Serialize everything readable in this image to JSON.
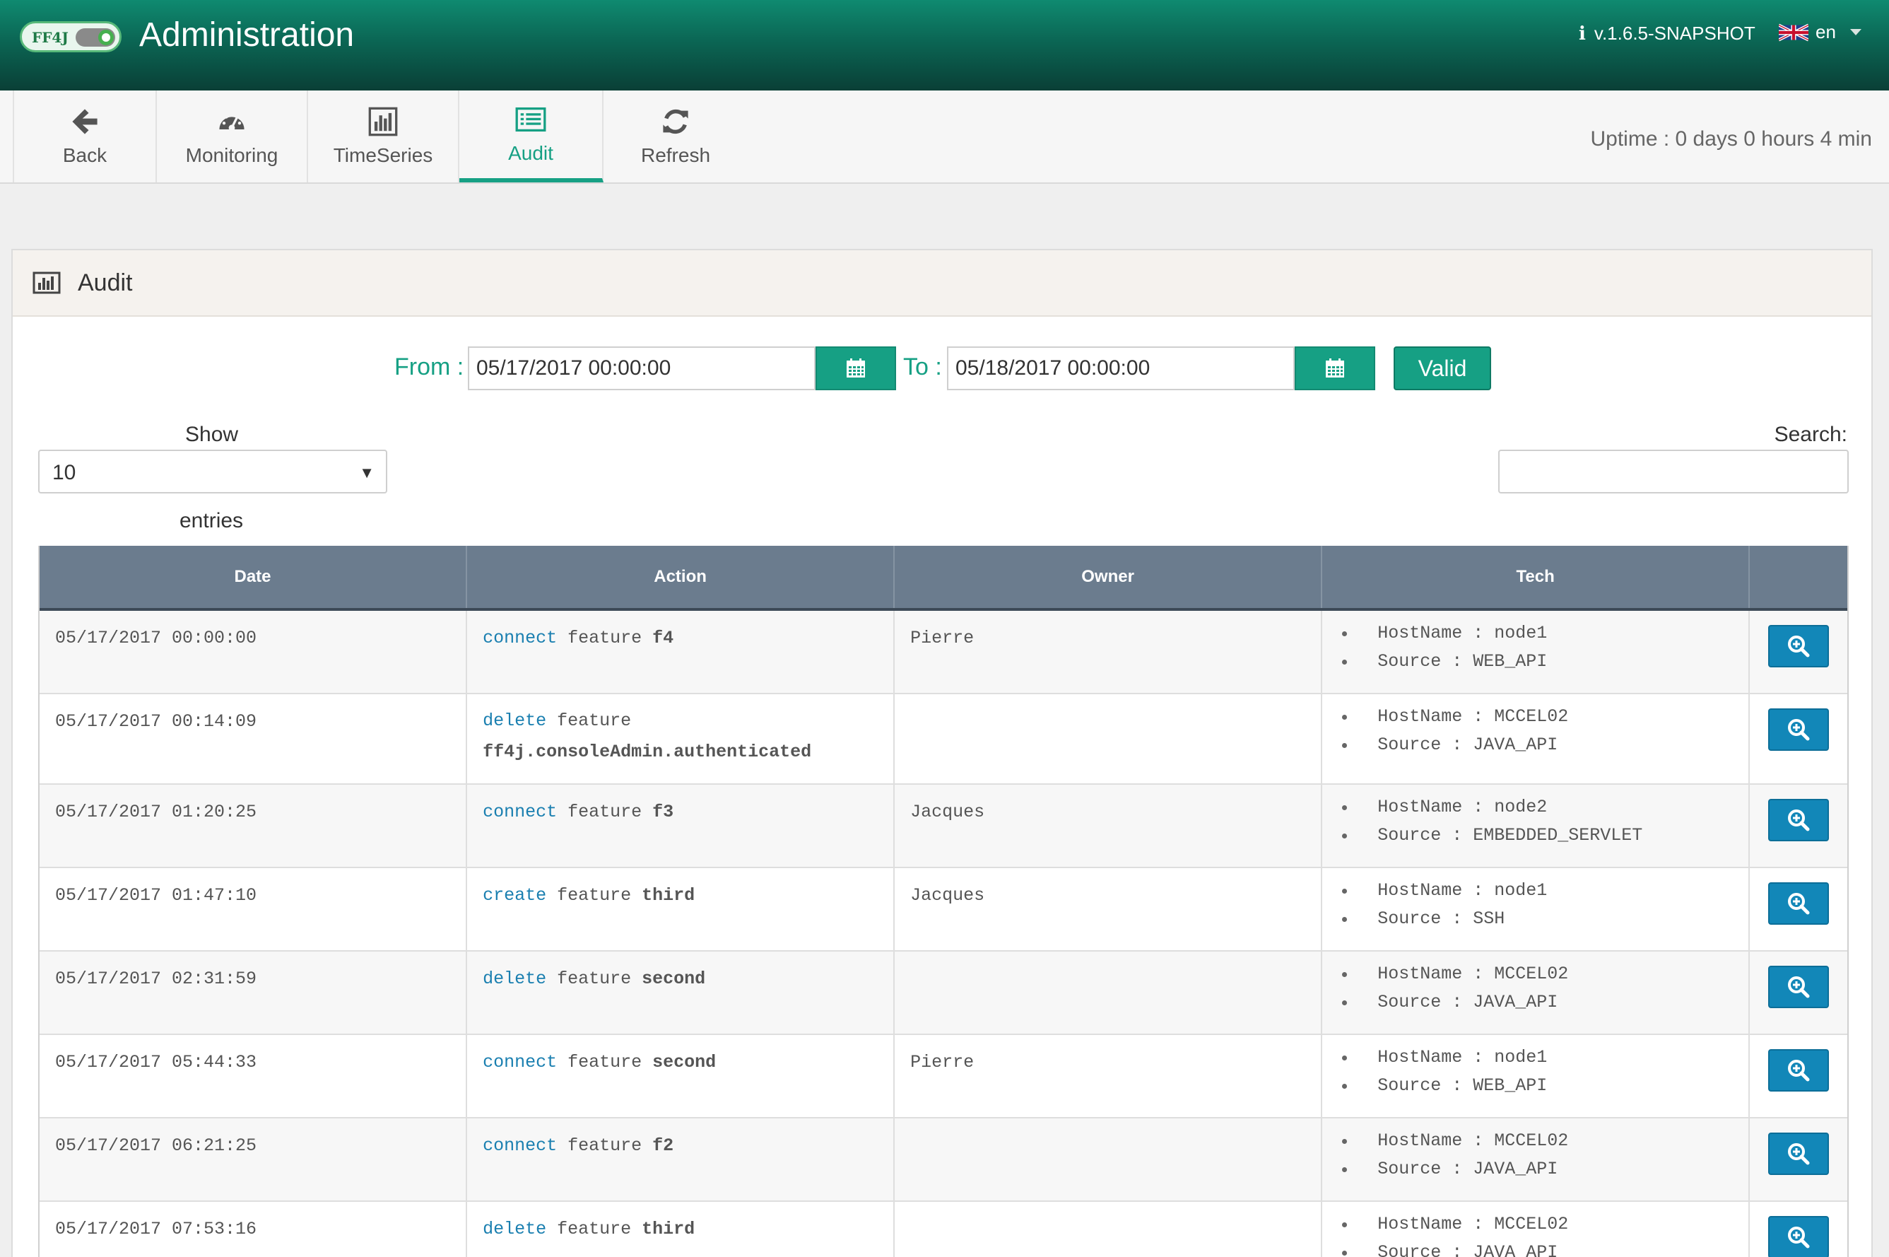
{
  "header": {
    "logo_text": "FF4J",
    "title": "Administration",
    "version": "v.1.6.5-SNAPSHOT",
    "language": "en",
    "brand_color": "#16a084"
  },
  "toolbar": {
    "items": [
      {
        "label": "Back",
        "icon": "arrow-left-icon"
      },
      {
        "label": "Monitoring",
        "icon": "dashboard-icon"
      },
      {
        "label": "TimeSeries",
        "icon": "bar-chart-icon"
      },
      {
        "label": "Audit",
        "icon": "list-icon",
        "active": true
      },
      {
        "label": "Refresh",
        "icon": "refresh-icon"
      }
    ],
    "uptime": "Uptime : 0 days 0 hours 4 min"
  },
  "panel": {
    "title": "Audit",
    "from_label": "From :",
    "from_value": "05/17/2017 00:00:00",
    "to_label": "To :",
    "to_value": "05/18/2017 00:00:00",
    "valid_label": "Valid",
    "show_label": "Show",
    "show_value": "10",
    "entries_label": "entries",
    "search_label": "Search:",
    "search_value": ""
  },
  "table": {
    "columns": [
      "Date",
      "Action",
      "Owner",
      "Tech",
      ""
    ],
    "rows": [
      {
        "date": "05/17/2017 00:00:00",
        "verb": "connect",
        "kw": "feature",
        "feature": "f4",
        "owner": "Pierre",
        "hostname": "HostName : node1",
        "source": "Source : WEB_API"
      },
      {
        "date": "05/17/2017 00:14:09",
        "verb": "delete",
        "kw": "feature",
        "feature": "ff4j.consoleAdmin.authenticated",
        "owner": "",
        "hostname": "HostName : MCCEL02",
        "source": "Source : JAVA_API"
      },
      {
        "date": "05/17/2017 01:20:25",
        "verb": "connect",
        "kw": "feature",
        "feature": "f3",
        "owner": "Jacques",
        "hostname": "HostName : node2",
        "source": "Source : EMBEDDED_SERVLET"
      },
      {
        "date": "05/17/2017 01:47:10",
        "verb": "create",
        "kw": "feature",
        "feature": "third",
        "owner": "Jacques",
        "hostname": "HostName : node1",
        "source": "Source : SSH"
      },
      {
        "date": "05/17/2017 02:31:59",
        "verb": "delete",
        "kw": "feature",
        "feature": "second",
        "owner": "",
        "hostname": "HostName : MCCEL02",
        "source": "Source : JAVA_API"
      },
      {
        "date": "05/17/2017 05:44:33",
        "verb": "connect",
        "kw": "feature",
        "feature": "second",
        "owner": "Pierre",
        "hostname": "HostName : node1",
        "source": "Source : WEB_API"
      },
      {
        "date": "05/17/2017 06:21:25",
        "verb": "connect",
        "kw": "feature",
        "feature": "f2",
        "owner": "",
        "hostname": "HostName : MCCEL02",
        "source": "Source : JAVA_API"
      },
      {
        "date": "05/17/2017 07:53:16",
        "verb": "delete",
        "kw": "feature",
        "feature": "third",
        "owner": "",
        "hostname": "HostName : MCCEL02",
        "source": "Source : JAVA_API"
      }
    ]
  }
}
